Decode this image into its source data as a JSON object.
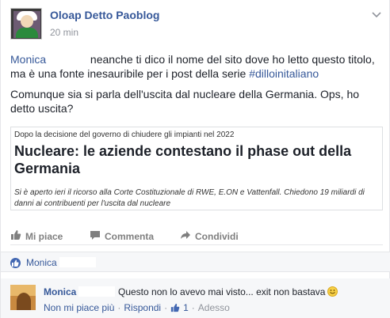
{
  "post": {
    "author": "Oloap Detto Paoblog",
    "time": "20 min",
    "menu_icon": "chevron-down-icon",
    "mention": "Monica",
    "line1": "neanche ti dico il nome del sito dove ho letto questo titolo, ma è una fonte inesauribile per i post della serie ",
    "hashtag": "#dilloinitaliano",
    "line2": "Comunque sia si parla dell'uscita dal nucleare della Germania. Ops, ho detto uscita?"
  },
  "link_card": {
    "kicker": "Dopo la decisione del governo di chiudere gli impianti nel 2022",
    "title": "Nucleare: le aziende contestano il phase out della Germania",
    "description": "Si è aperto ieri il ricorso alla Corte Costituzionale di RWE, E.ON e Vattenfall. Chiedono 19 miliardi di danni ai contribuenti per l'uscita dal nucleare"
  },
  "actions": {
    "like": "Mi piace",
    "comment": "Commenta",
    "share": "Condividi"
  },
  "likes": {
    "name": "Monica"
  },
  "comment": {
    "author": "Monica",
    "text": "Questo non lo avevo mai visto... exit non bastava",
    "unlike": "Non mi piace più",
    "reply": "Rispondi",
    "like_count": "1",
    "time": "Adesso",
    "separator": "·"
  },
  "colors": {
    "link": "#365899",
    "muted": "#90949c",
    "like_badge": "#4267b2"
  }
}
